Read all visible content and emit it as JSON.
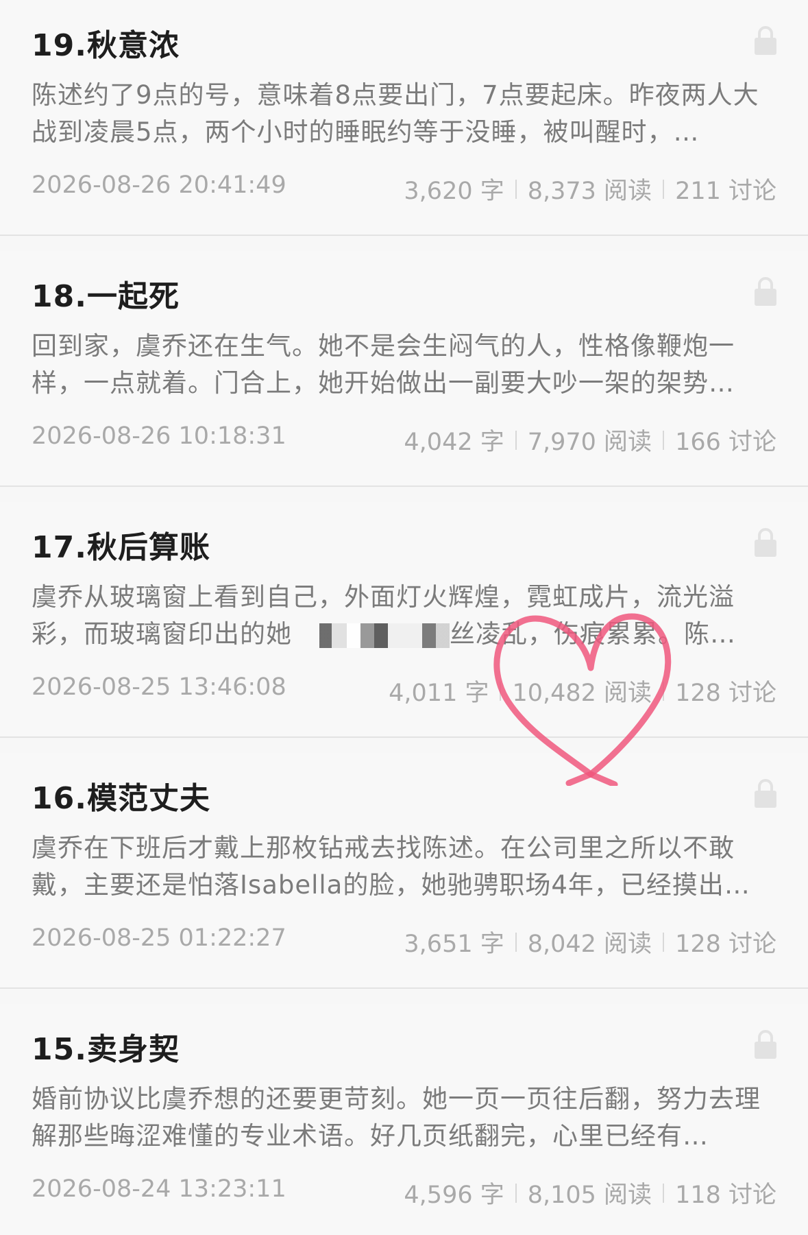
{
  "chapters": [
    {
      "title": "19.秋意浓",
      "excerpt": "陈述约了9点的号，意味着8点要出门，7点要起床。昨夜两人大战到凌晨5点，两个小时的睡眠约等于没睡，被叫醒时，…",
      "date": "2026-08-26 20:41:49",
      "words": "3,620 字",
      "reads": "8,373 阅读",
      "comments": "211 讨论",
      "icon": "lock-icon"
    },
    {
      "title": "18.一起死",
      "excerpt": "回到家，虞乔还在生气。她不是会生闷气的人，性格像鞭炮一样，一点就着。门合上，她开始做出一副要大吵一架的架势…",
      "date": "2026-08-26 10:18:31",
      "words": "4,042 字",
      "reads": "7,970 阅读",
      "comments": "166 讨论",
      "icon": "lock-icon"
    },
    {
      "title": "17.秋后算账",
      "excerpt_a": "虞乔从玻璃窗上看到自己，外面灯火辉煌，霓虹成片，流光溢彩，而玻璃窗印出的她",
      "excerpt_b": "丝凌乱，伤痕累累。陈…",
      "date": "2026-08-25 13:46:08",
      "words": "4,011 字",
      "reads": "10,482 阅读",
      "comments": "128 讨论",
      "icon": "lock-icon"
    },
    {
      "title": "16.模范丈夫",
      "excerpt": "虞乔在下班后才戴上那枚钻戒去找陈述。在公司里之所以不敢戴，主要还是怕落Isabella的脸，她驰骋职场4年，已经摸出…",
      "date": "2026-08-25 01:22:27",
      "words": "3,651 字",
      "reads": "8,042 阅读",
      "comments": "128 讨论",
      "icon": "lock-icon"
    },
    {
      "title": "15.卖身契",
      "excerpt": "婚前协议比虞乔想的还要更苛刻。她一页一页往后翻，努力去理解那些晦涩难懂的专业术语。好几页纸翻完，心里已经有…",
      "date": "2026-08-24 13:23:11",
      "words": "4,596 字",
      "reads": "8,105 阅读",
      "comments": "118 讨论",
      "icon": "lock-icon"
    }
  ],
  "colors": {
    "background": "#f8f8f8",
    "title": "#1e1e1e",
    "excerpt": "#7b7b7b",
    "meta": "#a9a9a9",
    "divider": "#e3e3e3",
    "lock": "#e2e2e2",
    "heart": "#f0587e"
  },
  "overlay_icon": "heart-doodle-icon"
}
